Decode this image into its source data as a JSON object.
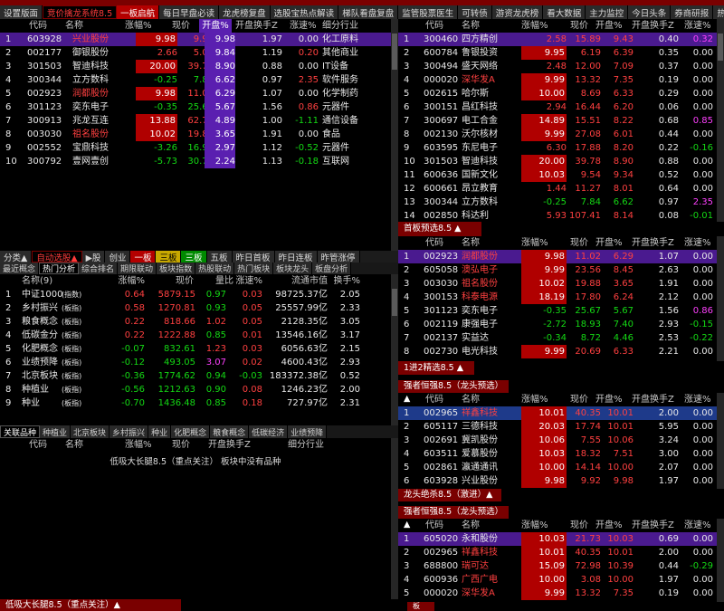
{
  "top_tabs": [
    "设置版面",
    "竞价擒龙系统8.5",
    "一板启航",
    "每日早盘必读",
    "龙虎榜复盘",
    "选股宝热点解读",
    "梯队看盘复盘",
    "监管股票医生",
    "可转债",
    "游资龙虎榜",
    "看大数据",
    "主力监控",
    "今日头条",
    "券商研报",
    "热点"
  ],
  "left_tabs": [
    "分类▲",
    "自动选股▲",
    "▶股",
    "创业",
    "一板",
    "三板",
    "三板",
    "五板",
    "昨日首板",
    "昨日连板",
    "昨管涨停"
  ],
  "sector_tabs": [
    "最近概念",
    "热门分析",
    "综合排名",
    "期限联动",
    "板块指数",
    "热股联动",
    "热门板块",
    "板块龙头",
    "板盘分析"
  ],
  "assoc_tabs": [
    "关联品种",
    "种植业",
    "北京板块",
    "乡村振兴",
    "种业",
    "化肥概念",
    "粮食概念",
    "低碳经济",
    "业绩预降"
  ],
  "main": {
    "h": [
      "代码",
      "名称",
      "涨幅%",
      "现价",
      "开盘%",
      "开盘换手Z",
      "涨速%",
      "细分行业"
    ],
    "rows": [
      [
        "1",
        "603928",
        "兴业股份",
        "9.98",
        "9.92",
        "9.98",
        "1.97",
        "0.00",
        "化工原料"
      ],
      [
        "2",
        "002177",
        "御银股份",
        "2.66",
        "5.01",
        "9.84",
        "1.19",
        "0.20",
        "其他商业"
      ],
      [
        "3",
        "301503",
        "智迪科技",
        "20.00",
        "39.78",
        "8.90",
        "0.88",
        "0.00",
        "IT设备"
      ],
      [
        "4",
        "300344",
        "立方数科",
        "-0.25",
        "7.84",
        "6.62",
        "0.97",
        "2.35",
        "软件服务"
      ],
      [
        "5",
        "002923",
        "润都股份",
        "9.98",
        "11.02",
        "6.29",
        "1.07",
        "0.00",
        "化学制药"
      ],
      [
        "6",
        "301123",
        "奕东电子",
        "-0.35",
        "25.67",
        "5.67",
        "1.56",
        "0.86",
        "元器件"
      ],
      [
        "7",
        "300913",
        "兆龙互连",
        "13.88",
        "62.70",
        "4.89",
        "1.00",
        "-1.11",
        "通信设备"
      ],
      [
        "8",
        "003030",
        "祖名股份",
        "10.02",
        "19.88",
        "3.65",
        "1.91",
        "0.00",
        "食品"
      ],
      [
        "9",
        "002552",
        "宝鼎科技",
        "-3.26",
        "16.91",
        "2.97",
        "1.12",
        "-0.52",
        "元器件"
      ],
      [
        "10",
        "300792",
        "壹网壹创",
        "-5.73",
        "30.79",
        "2.24",
        "1.13",
        "-0.18",
        "互联网"
      ]
    ]
  },
  "sector": {
    "title": "名称(9)",
    "h": [
      "名称(9)",
      "涨幅%",
      "现价",
      "量比",
      "涨速%",
      "流通市值",
      "换手%"
    ],
    "rows": [
      [
        "1",
        "中证1000",
        "(指数)",
        "0.64",
        "5879.15",
        "0.97",
        "0.03",
        "98725.37亿",
        "2.05"
      ],
      [
        "2",
        "乡村振兴",
        "(板指)",
        "0.58",
        "1270.81",
        "0.93",
        "0.05",
        "25557.99亿",
        "2.33"
      ],
      [
        "3",
        "粮食概念",
        "(板指)",
        "0.22",
        "818.66",
        "1.02",
        "0.05",
        "2128.35亿",
        "3.05"
      ],
      [
        "4",
        "低碳金分",
        "(板指)",
        "0.22",
        "1222.88",
        "0.85",
        "0.01",
        "13546.16亿",
        "3.17"
      ],
      [
        "5",
        "化肥概念",
        "(板指)",
        "-0.07",
        "832.61",
        "1.23",
        "0.03",
        "6056.63亿",
        "2.15"
      ],
      [
        "6",
        "业绩预降",
        "(板指)",
        "-0.12",
        "493.05",
        "3.07",
        "0.02",
        "4600.43亿",
        "2.93"
      ],
      [
        "7",
        "北京板块",
        "(板指)",
        "-0.36",
        "1774.62",
        "0.94",
        "-0.03",
        "183372.38亿",
        "0.52"
      ],
      [
        "8",
        "种植业",
        "(板指)",
        "-0.56",
        "1212.63",
        "0.90",
        "0.08",
        "1246.23亿",
        "2.00"
      ],
      [
        "9",
        "种业",
        "(板指)",
        "-0.70",
        "1436.48",
        "0.85",
        "0.18",
        "727.97亿",
        "2.31"
      ]
    ]
  },
  "assoc": {
    "h": [
      "代码",
      "名称",
      "涨幅%",
      "现价",
      "开盘换手Z",
      "细分行业"
    ],
    "note": "低吸大长腿8.5（重点关注） 板块中没有品种",
    "bottom": "低吸大长腿8.5（重点关注）▲"
  },
  "right_top": {
    "h": [
      "代码",
      "名称",
      "涨幅%",
      "现价",
      "开盘%",
      "开盘换手Z",
      "涨速%"
    ],
    "rows": [
      [
        "1",
        "300460",
        "四方精创",
        "2.58",
        "15.89",
        "9.43",
        "0.40",
        "0.32"
      ],
      [
        "2",
        "600784",
        "鲁银投资",
        "9.95",
        "6.19",
        "6.39",
        "0.35",
        "0.00"
      ],
      [
        "3",
        "300494",
        "盛天网络",
        "2.48",
        "12.00",
        "7.09",
        "0.37",
        "0.00"
      ],
      [
        "4",
        "000020",
        "深华发A",
        "9.99",
        "13.32",
        "7.35",
        "0.19",
        "0.00"
      ],
      [
        "5",
        "002615",
        "哈尔斯",
        "10.00",
        "8.69",
        "6.33",
        "0.29",
        "0.00"
      ],
      [
        "6",
        "300151",
        "昌红科技",
        "2.94",
        "16.44",
        "6.20",
        "0.06",
        "0.00"
      ],
      [
        "7",
        "300697",
        "电工合金",
        "14.89",
        "15.51",
        "8.22",
        "0.68",
        "0.85"
      ],
      [
        "8",
        "002130",
        "沃尔核材",
        "9.99",
        "27.08",
        "6.01",
        "0.44",
        "0.00"
      ],
      [
        "9",
        "603595",
        "东尼电子",
        "6.30",
        "17.88",
        "8.20",
        "0.22",
        "-0.16"
      ],
      [
        "10",
        "301503",
        "智迪科技",
        "20.00",
        "39.78",
        "8.90",
        "0.88",
        "0.00"
      ],
      [
        "11",
        "600636",
        "国新文化",
        "10.03",
        "9.54",
        "9.34",
        "0.52",
        "0.00"
      ],
      [
        "12",
        "600661",
        "昂立教育",
        "1.44",
        "11.27",
        "8.01",
        "0.64",
        "0.00"
      ],
      [
        "13",
        "300344",
        "立方数科",
        "-0.25",
        "7.84",
        "6.62",
        "0.97",
        "2.35"
      ],
      [
        "14",
        "002850",
        "科达利",
        "5.93",
        "107.41",
        "8.14",
        "0.08",
        "-0.01"
      ]
    ]
  },
  "first_board": {
    "title": "首板预选8.5 ▲",
    "h": [
      "代码",
      "名称",
      "涨幅%",
      "现价",
      "开盘%",
      "开盘换手Z",
      "涨速%"
    ],
    "rows": [
      [
        "1",
        "002923",
        "润都股份",
        "9.98",
        "11.02",
        "6.29",
        "1.07",
        "0.00"
      ],
      [
        "2",
        "605058",
        "澳弘电子",
        "9.99",
        "23.56",
        "8.45",
        "2.63",
        "0.00"
      ],
      [
        "3",
        "003030",
        "祖名股份",
        "10.02",
        "19.88",
        "3.65",
        "1.91",
        "0.00"
      ],
      [
        "4",
        "300153",
        "科泰电源",
        "18.19",
        "17.80",
        "6.24",
        "2.12",
        "0.00"
      ],
      [
        "5",
        "301123",
        "奕东电子",
        "-0.35",
        "25.67",
        "5.67",
        "1.56",
        "0.86"
      ],
      [
        "6",
        "002119",
        "康强电子",
        "-2.72",
        "18.93",
        "7.40",
        "2.93",
        "-0.15"
      ],
      [
        "7",
        "002137",
        "实益达",
        "-0.34",
        "8.72",
        "4.46",
        "2.53",
        "-0.22"
      ],
      [
        "8",
        "002730",
        "电光科技",
        "9.99",
        "20.69",
        "6.33",
        "2.21",
        "0.00"
      ]
    ]
  },
  "one_two": {
    "title": "1进2精选8.5 ▲"
  },
  "strong1": {
    "title": "强者恒强8.5（龙头预选）▲",
    "h": [
      "代码",
      "名称",
      "涨幅%",
      "现价",
      "开盘%",
      "开盘换手Z",
      "涨速%"
    ],
    "rows": [
      [
        "1",
        "002965",
        "祥鑫科技",
        "10.01",
        "40.35",
        "10.01",
        "2.00",
        "0.00"
      ],
      [
        "2",
        "605117",
        "三德科技",
        "20.03",
        "17.74",
        "10.01",
        "5.95",
        "0.00"
      ],
      [
        "3",
        "002691",
        "冀凯股份",
        "10.06",
        "7.55",
        "10.06",
        "3.24",
        "0.00"
      ],
      [
        "4",
        "603511",
        "爱慕股份",
        "10.03",
        "18.32",
        "7.51",
        "3.00",
        "0.00"
      ],
      [
        "5",
        "002861",
        "瀛通通讯",
        "10.00",
        "14.14",
        "10.00",
        "2.07",
        "0.00"
      ],
      [
        "6",
        "603928",
        "兴业股份",
        "9.98",
        "9.92",
        "9.98",
        "1.97",
        "0.00"
      ]
    ]
  },
  "dragon": {
    "title": "龙头绝杀8.5（激进）▲"
  },
  "strong2": {
    "title": "强者恒强8.5（龙头预选）▲",
    "h": [
      "代码",
      "名称",
      "涨幅%",
      "现价",
      "开盘%",
      "开盘换手Z",
      "涨速%"
    ],
    "rows": [
      [
        "1",
        "605020",
        "永和股份",
        "10.03",
        "21.73",
        "10.03",
        "0.69",
        "0.00"
      ],
      [
        "2",
        "002965",
        "祥鑫科技",
        "10.01",
        "40.35",
        "10.01",
        "2.00",
        "0.00"
      ],
      [
        "3",
        "688800",
        "瑞可达",
        "15.09",
        "72.98",
        "10.39",
        "0.44",
        "-0.29"
      ],
      [
        "4",
        "600936",
        "广西广电",
        "10.00",
        "3.08",
        "10.00",
        "1.97",
        "0.00"
      ],
      [
        "5",
        "000020",
        "深华发A",
        "9.99",
        "13.32",
        "7.35",
        "0.19",
        "0.00"
      ]
    ]
  },
  "footer": {
    "left": "低吸大长腿8.5（重点关注）▲",
    "right": "板"
  },
  "colors": {
    "up": "#ff4040",
    "down": "#14d914",
    "flat": "#e8e8e8",
    "highlight_purple": "#5a1fb0",
    "red_bg": "#b00000",
    "section_title": "#7a0000"
  }
}
